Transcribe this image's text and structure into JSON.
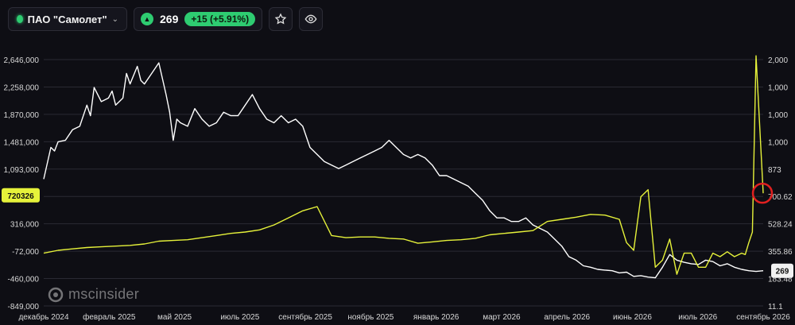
{
  "header": {
    "ticker_name": "ПАО \"Самолет\"",
    "price": "269",
    "change": "+15 (+5.91%)",
    "colors": {
      "up": "#2ecc71",
      "line_white": "#ffffff",
      "line_yellow": "#e6f23a",
      "marker": "#e02020"
    }
  },
  "icons": {
    "status": "green-dot-icon",
    "dropdown": "chevron-down-icon",
    "up": "triangle-up-icon",
    "favorite": "star-icon",
    "watch": "eye-icon",
    "brand": "msc-logo-icon"
  },
  "watermark": {
    "text": "mscinsider"
  },
  "chart_data": {
    "type": "line",
    "title": "",
    "x_ticks": [
      "декабрь 2024",
      "февраль 2025",
      "май 2025",
      "июль 2025",
      "сентябрь 2025",
      "ноябрь 2025",
      "январь 2026",
      "март 2026",
      "апрель 2026",
      "июнь 2026",
      "июль 2026",
      "сентябрь 2026"
    ],
    "left_axis": {
      "ticks": [
        "2,646,000",
        "2,258,000",
        "1,870,000",
        "1,481,000",
        "1,093,000",
        "704,000",
        "316,000",
        "-72,000",
        "-460,000",
        "-849,000"
      ],
      "range": [
        -849000,
        2646000
      ],
      "current_label": "720326"
    },
    "right_axis": {
      "ticks": [
        "2,000",
        "1,000",
        "1,000",
        "1,000",
        "873",
        "700.62",
        "528.24",
        "355.86",
        "183.48",
        "11.1"
      ],
      "current_label": "269"
    },
    "series": [
      {
        "axis": "left",
        "color": "#ffffff",
        "x": [
          0,
          0.01,
          0.015,
          0.02,
          0.03,
          0.04,
          0.05,
          0.06,
          0.065,
          0.07,
          0.08,
          0.09,
          0.095,
          0.1,
          0.11,
          0.115,
          0.12,
          0.13,
          0.135,
          0.14,
          0.15,
          0.16,
          0.17,
          0.175,
          0.18,
          0.185,
          0.19,
          0.2,
          0.21,
          0.22,
          0.23,
          0.24,
          0.25,
          0.26,
          0.27,
          0.28,
          0.29,
          0.3,
          0.31,
          0.32,
          0.33,
          0.34,
          0.35,
          0.36,
          0.37,
          0.38,
          0.39,
          0.4,
          0.41,
          0.42,
          0.43,
          0.44,
          0.45,
          0.46,
          0.47,
          0.48,
          0.49,
          0.5,
          0.51,
          0.52,
          0.53,
          0.54,
          0.55,
          0.56,
          0.57,
          0.58,
          0.59,
          0.6,
          0.61,
          0.62,
          0.63,
          0.64,
          0.65,
          0.66,
          0.67,
          0.68,
          0.69,
          0.7,
          0.71,
          0.72,
          0.73,
          0.74,
          0.75,
          0.76,
          0.77,
          0.78,
          0.79,
          0.8,
          0.81,
          0.82,
          0.83,
          0.84,
          0.85,
          0.86,
          0.87,
          0.88,
          0.89,
          0.9,
          0.91,
          0.92,
          0.93,
          0.94,
          0.95,
          0.96,
          0.97,
          0.98,
          0.99,
          1.0
        ],
        "y": [
          950000,
          1400000,
          1350000,
          1480000,
          1500000,
          1650000,
          1700000,
          2000000,
          1850000,
          2250000,
          2050000,
          2100000,
          2200000,
          2000000,
          2100000,
          2450000,
          2300000,
          2550000,
          2350000,
          2300000,
          2450000,
          2600000,
          2150000,
          1900000,
          1500000,
          1800000,
          1750000,
          1700000,
          1950000,
          1800000,
          1700000,
          1750000,
          1900000,
          1850000,
          1850000,
          2000000,
          2150000,
          1950000,
          1800000,
          1750000,
          1850000,
          1750000,
          1800000,
          1700000,
          1400000,
          1300000,
          1200000,
          1150000,
          1100000,
          1150000,
          1200000,
          1250000,
          1300000,
          1350000,
          1400000,
          1500000,
          1400000,
          1300000,
          1250000,
          1300000,
          1250000,
          1150000,
          1000000,
          1000000,
          950000,
          900000,
          850000,
          750000,
          650000,
          500000,
          400000,
          400000,
          350000,
          350000,
          400000,
          300000,
          250000,
          200000,
          100000,
          0,
          -150000,
          -200000,
          -280000,
          -300000,
          -330000,
          -340000,
          -350000,
          -380000,
          -370000,
          -430000,
          -420000,
          -440000,
          -450000,
          -300000,
          -120000,
          -200000,
          -230000,
          -250000,
          -260000,
          -200000,
          -220000,
          -280000,
          -250000,
          -300000,
          -330000,
          -350000,
          -360000,
          -350000
        ]
      },
      {
        "axis": "left",
        "color": "#e6f23a",
        "x": [
          0,
          0.02,
          0.04,
          0.06,
          0.08,
          0.1,
          0.12,
          0.14,
          0.16,
          0.18,
          0.2,
          0.22,
          0.24,
          0.26,
          0.28,
          0.3,
          0.32,
          0.34,
          0.36,
          0.38,
          0.4,
          0.42,
          0.44,
          0.46,
          0.48,
          0.5,
          0.52,
          0.54,
          0.56,
          0.58,
          0.6,
          0.62,
          0.64,
          0.66,
          0.68,
          0.7,
          0.72,
          0.74,
          0.76,
          0.78,
          0.8,
          0.81,
          0.82,
          0.83,
          0.84,
          0.85,
          0.86,
          0.87,
          0.88,
          0.89,
          0.9,
          0.91,
          0.92,
          0.93,
          0.94,
          0.95,
          0.96,
          0.97,
          0.975,
          0.98,
          0.985,
          0.99,
          1.0
        ],
        "y": [
          -100000,
          -60000,
          -40000,
          -20000,
          -10000,
          0,
          10000,
          30000,
          70000,
          80000,
          90000,
          120000,
          150000,
          180000,
          200000,
          230000,
          300000,
          400000,
          500000,
          560000,
          150000,
          120000,
          130000,
          130000,
          110000,
          100000,
          40000,
          60000,
          80000,
          90000,
          110000,
          160000,
          180000,
          200000,
          220000,
          350000,
          380000,
          410000,
          450000,
          440000,
          380000,
          50000,
          -60000,
          700000,
          800000,
          -300000,
          -200000,
          100000,
          -400000,
          -100000,
          -100000,
          -300000,
          -300000,
          -100000,
          -150000,
          -80000,
          -150000,
          -100000,
          -120000,
          50000,
          200000,
          2700000,
          750000
        ]
      }
    ]
  }
}
